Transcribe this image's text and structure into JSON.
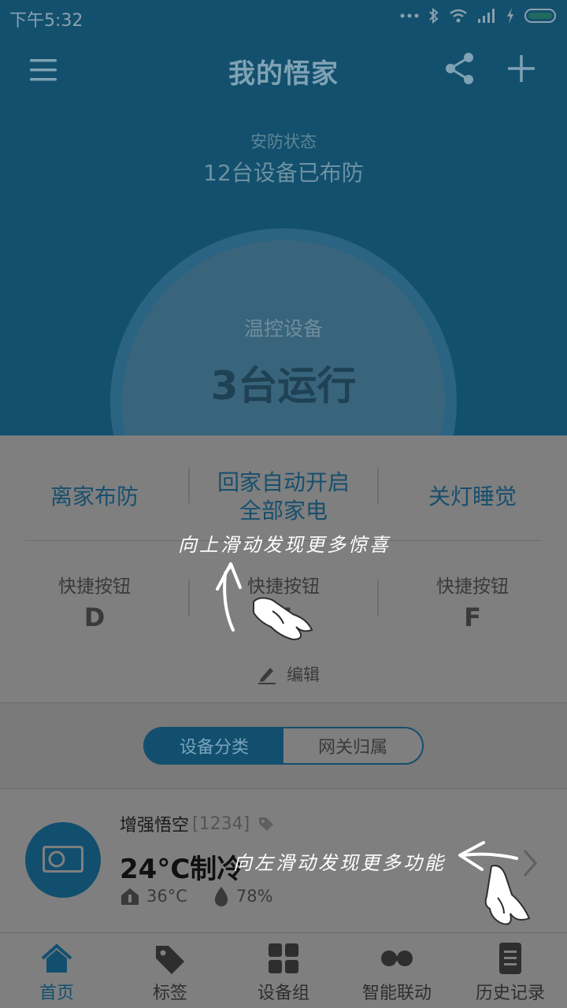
{
  "status_bar": {
    "time": "下午5:32"
  },
  "header": {
    "title": "我的悟家"
  },
  "security": {
    "label": "安防状态",
    "value": "12台设备已布防"
  },
  "thermo": {
    "label": "温控设备",
    "value": "3台运行"
  },
  "scenes": [
    {
      "label": "离家布防"
    },
    {
      "label_line1": "回家自动开启",
      "label_line2": "全部家电"
    },
    {
      "label": "关灯睡觉"
    }
  ],
  "quick_buttons": [
    {
      "label": "快捷按钮",
      "letter": "D"
    },
    {
      "label": "快捷按钮",
      "letter": "E"
    },
    {
      "label": "快捷按钮",
      "letter": "F"
    }
  ],
  "edit": {
    "label": "编辑"
  },
  "hints": {
    "swipe_up": "向上滑动发现更多惊喜",
    "swipe_left": "向左滑动发现更多功能"
  },
  "segment": {
    "left": "设备分类",
    "right": "网关归属",
    "active": "left"
  },
  "device": {
    "name": "增强悟空",
    "id": "[1234]",
    "status": "24°C制冷",
    "temperature": "36°C",
    "humidity": "78%"
  },
  "bottom_nav": [
    {
      "label": "首页",
      "icon": "home-icon",
      "active": true
    },
    {
      "label": "标签",
      "icon": "tag-icon",
      "active": false
    },
    {
      "label": "设备组",
      "icon": "grid-icon",
      "active": false
    },
    {
      "label": "智能联动",
      "icon": "link-icon",
      "active": false
    },
    {
      "label": "历史记录",
      "icon": "history-icon",
      "active": false
    }
  ],
  "colors": {
    "accent": "#124f6f",
    "header_bg": "#13506e",
    "overlay_gray": "#7f7f7f"
  }
}
